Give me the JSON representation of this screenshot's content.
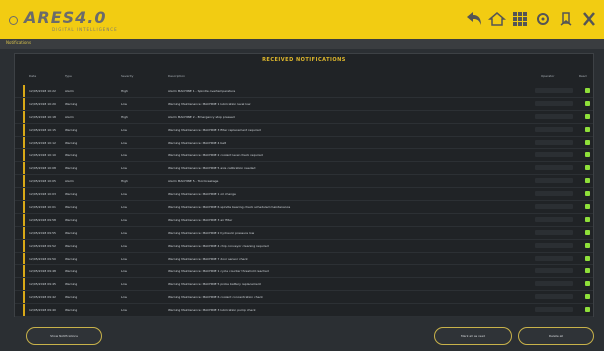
{
  "header": {
    "logo": "ARES4.0",
    "tagline": "DIGITAL INTELLIGENCE"
  },
  "subbar": {
    "text": "Notifications"
  },
  "panel": {
    "title": "RECEIVED NOTIFICATIONS",
    "columns": [
      "Date",
      "Type",
      "Severity",
      "Description",
      "Operator",
      "Read"
    ],
    "rows": [
      {
        "date": "12/05/2018 10:22",
        "type": "Alarm",
        "sev": "High",
        "desc": "Alarm MACHINE 1 - Spindle overtemperature"
      },
      {
        "date": "12/05/2018 10:20",
        "type": "Warning",
        "sev": "Low",
        "desc": "Warning Maintenance: MACHINE 1 lubrication level low"
      },
      {
        "date": "12/05/2018 10:18",
        "type": "Alarm",
        "sev": "High",
        "desc": "Alarm MACHINE 2 - Emergency stop pressed"
      },
      {
        "date": "12/05/2018 10:15",
        "type": "Warning",
        "sev": "Low",
        "desc": "Warning Maintenance: MACHINE 3 filter replacement required"
      },
      {
        "date": "12/05/2018 10:12",
        "type": "Warning",
        "sev": "Low",
        "desc": "Warning Maintenance: MACHINE 4 belt"
      },
      {
        "date": "12/05/2018 10:10",
        "type": "Warning",
        "sev": "Low",
        "desc": "Warning Maintenance: MACHINE 2 coolant level check required"
      },
      {
        "date": "12/05/2018 10:08",
        "type": "Warning",
        "sev": "Low",
        "desc": "Warning Maintenance: MACHINE 5 axis calibration needed"
      },
      {
        "date": "12/05/2018 10:05",
        "type": "Alarm",
        "sev": "High",
        "desc": "Alarm MACHINE 5 - Tool breakage"
      },
      {
        "date": "12/05/2018 10:03",
        "type": "Warning",
        "sev": "Low",
        "desc": "Warning Maintenance: MACHINE 1 oil change"
      },
      {
        "date": "12/05/2018 10:01",
        "type": "Warning",
        "sev": "Low",
        "desc": "Warning Maintenance: MACHINE 6 spindle bearing check scheduled maintenance"
      },
      {
        "date": "12/05/2018 09:58",
        "type": "Warning",
        "sev": "Low",
        "desc": "Warning Maintenance: MACHINE 3 air filter"
      },
      {
        "date": "12/05/2018 09:55",
        "type": "Warning",
        "sev": "Low",
        "desc": "Warning Maintenance: MACHINE 2 hydraulic pressure low"
      },
      {
        "date": "12/05/2018 09:52",
        "type": "Warning",
        "sev": "Low",
        "desc": "Warning Maintenance: MACHINE 4 chip conveyor cleaning required"
      },
      {
        "date": "12/05/2018 09:50",
        "type": "Warning",
        "sev": "Low",
        "desc": "Warning Maintenance: MACHINE 7 door sensor check"
      },
      {
        "date": "12/05/2018 09:48",
        "type": "Warning",
        "sev": "Low",
        "desc": "Warning Maintenance: MACHINE 1 cycle counter threshold reached"
      },
      {
        "date": "12/05/2018 09:45",
        "type": "Warning",
        "sev": "Low",
        "desc": "Warning Maintenance: MACHINE 5 probe battery replacement"
      },
      {
        "date": "12/05/2018 09:42",
        "type": "Warning",
        "sev": "Low",
        "desc": "Warning Maintenance: MACHINE 6 coolant concentration check"
      },
      {
        "date": "12/05/2018 09:40",
        "type": "Warning",
        "sev": "Low",
        "desc": "Warning Maintenance: MACHINE 3 lubrication pump check"
      }
    ]
  },
  "footer": {
    "left_button": "Show Notifications",
    "mid_button": "Mark all as read",
    "right_button": "Delete all"
  },
  "colors": {
    "accent": "#f2cc12",
    "panel_bg": "#202326",
    "read_icon": "#8fe03a"
  }
}
